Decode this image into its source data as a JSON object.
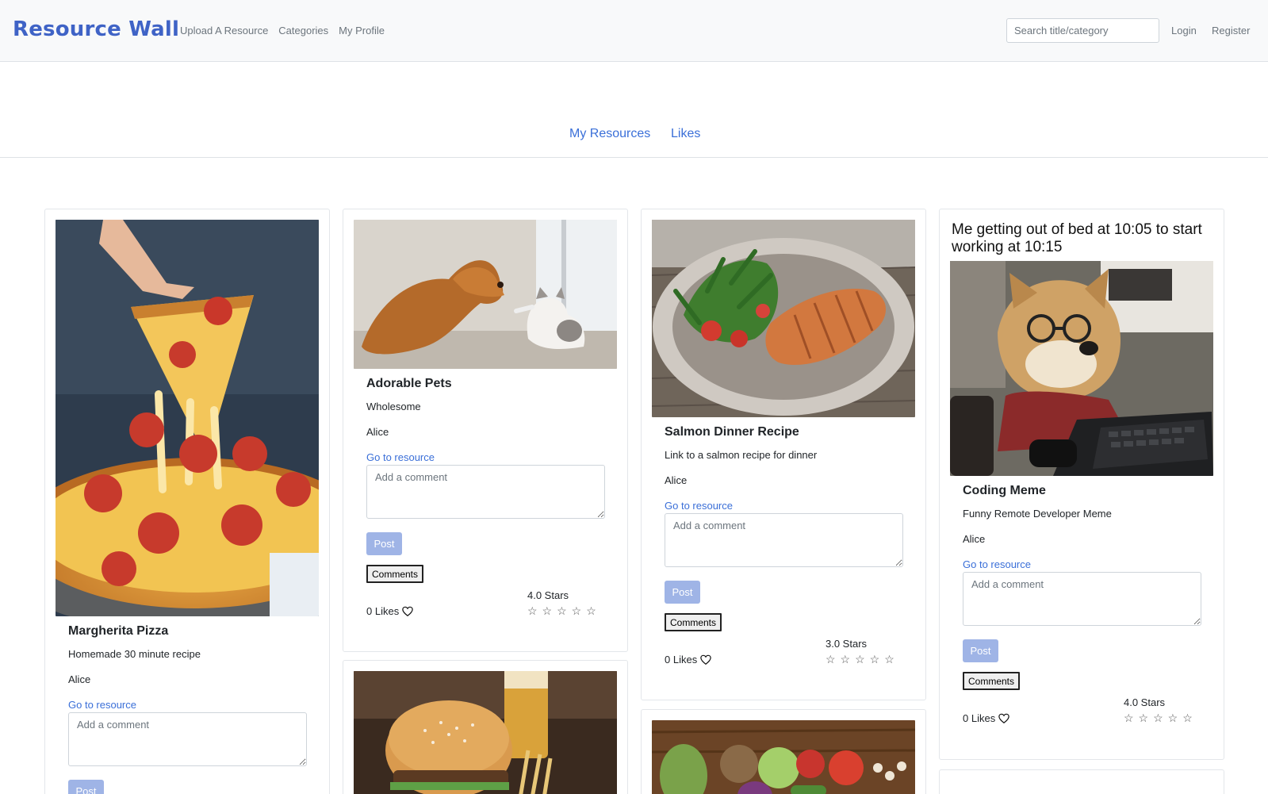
{
  "navbar": {
    "brand": "Resource Wall",
    "links": [
      "Upload A Resource",
      "Categories",
      "My Profile"
    ],
    "search_placeholder": "Search title/category",
    "login": "Login",
    "register": "Register"
  },
  "profile_tabs": [
    "My Resources",
    "Likes"
  ],
  "cards": [
    {
      "title": "Margherita Pizza",
      "description": "Homemade 30 minute recipe",
      "author": "Alice",
      "link_text": "Go to resource",
      "comment_placeholder": "Add a comment",
      "post_label": "Post",
      "image": "pizza-photo"
    },
    {
      "title": "Adorable Pets",
      "description": "Wholesome",
      "author": "Alice",
      "link_text": "Go to resource",
      "comment_placeholder": "Add a comment",
      "post_label": "Post",
      "comments_label": "Comments",
      "likes": "0 Likes",
      "rating": "4.0 Stars",
      "stars": "☆☆☆☆☆",
      "image": "dog-and-cat-photo"
    },
    {
      "title": "Salmon Dinner Recipe",
      "description": "Link to a salmon recipe for dinner",
      "author": "Alice",
      "link_text": "Go to resource",
      "comment_placeholder": "Add a comment",
      "post_label": "Post",
      "comments_label": "Comments",
      "likes": "0 Likes",
      "rating": "3.0 Stars",
      "stars": "☆☆☆☆☆",
      "image": "salmon-photo"
    },
    {
      "title": "Coding Meme",
      "description": "Funny Remote Developer Meme",
      "author": "Alice",
      "link_text": "Go to resource",
      "comment_placeholder": "Add a comment",
      "post_label": "Post",
      "comments_label": "Comments",
      "likes": "0 Likes",
      "rating": "4.0 Stars",
      "stars": "☆☆☆☆☆",
      "image": "coding-dog-meme",
      "meme_caption_line1": "Me getting out of bed at 10:05 to start",
      "meme_caption_line2": "working at 10:15"
    },
    {
      "image": "burger-photo"
    },
    {
      "image": "vegetables-photo"
    }
  ]
}
